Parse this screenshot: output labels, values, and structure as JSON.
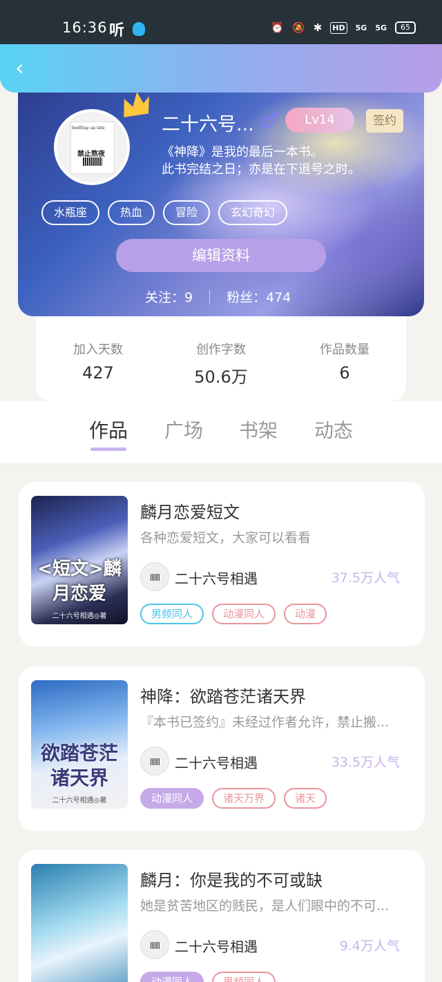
{
  "statusbar": {
    "time": "16:36",
    "ting": "听",
    "hd": "HD",
    "sig1": "5G",
    "sig2": "5G",
    "battery": "65"
  },
  "profile": {
    "nickname": "二十六号...",
    "gender_symbol": "♂",
    "level": "Lv14",
    "signed": "签约",
    "bio_line1": "《神降》是我的最后一本书。",
    "bio_line2": "此书完结之日；亦是在下退号之时。",
    "tags": [
      "水瓶座",
      "热血",
      "冒险",
      "玄幻奇幻"
    ],
    "edit_label": "编辑资料",
    "follow_label": "关注：9",
    "fans_label": "粉丝：474",
    "avatar_text1": "bedStay up late",
    "avatar_text2": "禁止熬夜"
  },
  "stats": [
    {
      "label": "加入天数",
      "value": "427"
    },
    {
      "label": "创作字数",
      "value": "50.6万"
    },
    {
      "label": "作品数量",
      "value": "6"
    }
  ],
  "tabs": [
    "作品",
    "广场",
    "书架",
    "动态"
  ],
  "works": [
    {
      "title": "麟月恋爱短文",
      "desc": "各种恋爱短文，大家可以看看",
      "author": "二十六号相遇",
      "popularity": "37.5万人气",
      "cover_title": "<短文>麟月恋爱",
      "cover_author": "二十六号相遇◎著",
      "tags": [
        {
          "text": "男频同人",
          "style": "blue"
        },
        {
          "text": "动漫同人",
          "style": "red"
        },
        {
          "text": "动漫",
          "style": "red"
        }
      ]
    },
    {
      "title": "神降：欲踏苍茫诸天界",
      "desc": "『本书已签约』未经过作者允许，禁止搬...",
      "author": "二十六号相遇",
      "popularity": "33.5万人气",
      "cover_title": "欲踏苍茫诸天界",
      "cover_author": "二十六号相遇◎著",
      "tags": [
        {
          "text": "动漫同人",
          "style": "purple"
        },
        {
          "text": "诸天万界",
          "style": "red"
        },
        {
          "text": "诸天",
          "style": "red"
        }
      ]
    },
    {
      "title": "麟月：你是我的不可或缺",
      "desc": "她是贫苦地区的贱民，是人们眼中的不可...",
      "author": "二十六号相遇",
      "popularity": "9.4万人气",
      "cover_title": "",
      "cover_author": "",
      "tags": [
        {
          "text": "动漫同人",
          "style": "purple"
        },
        {
          "text": "男频同人",
          "style": "red"
        }
      ]
    }
  ],
  "colors": {
    "accent": "#c6b5ee",
    "header_start": "#58d3f3",
    "header_end": "#b79ee7"
  }
}
